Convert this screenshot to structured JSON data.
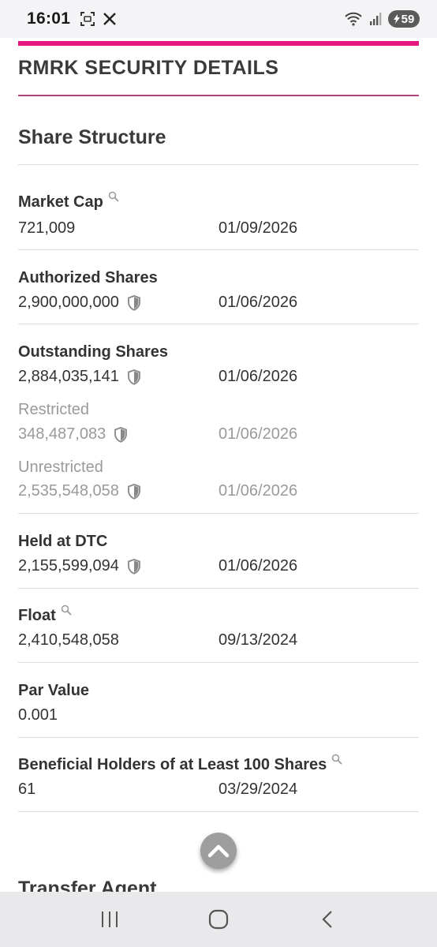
{
  "status_bar": {
    "time": "16:01",
    "battery": "59",
    "icons": [
      "screenshot-icon",
      "x-logo-icon",
      "wifi-icon",
      "signal-icon",
      "battery-icon"
    ]
  },
  "section": {
    "title": "RMRK SECURITY DETAILS",
    "accent_color": "#e5177e"
  },
  "share_structure": {
    "title": "Share Structure",
    "rows": [
      {
        "label": "Market Cap",
        "value": "721,009",
        "date": "01/09/2026"
      },
      {
        "label": "Authorized Shares",
        "value": "2,900,000,000",
        "date": "01/06/2026"
      },
      {
        "label": "Outstanding Shares",
        "value": "2,884,035,141",
        "date": "01/06/2026"
      },
      {
        "label": "Restricted",
        "value": "348,487,083",
        "date": "01/06/2026"
      },
      {
        "label": "Unrestricted",
        "value": "2,535,548,058",
        "date": "01/06/2026"
      },
      {
        "label": "Held at DTC",
        "value": "2,155,599,094",
        "date": "01/06/2026"
      },
      {
        "label": "Float",
        "value": "2,410,548,058",
        "date": "09/13/2024"
      },
      {
        "label": "Par Value",
        "value": "0.001",
        "date": ""
      },
      {
        "label": "Beneficial Holders of at Least 100 Shares",
        "value": "61",
        "date": "03/29/2024"
      }
    ]
  },
  "next_section": {
    "title": "Transfer Agent",
    "partial_text": "Transfer Agent"
  }
}
